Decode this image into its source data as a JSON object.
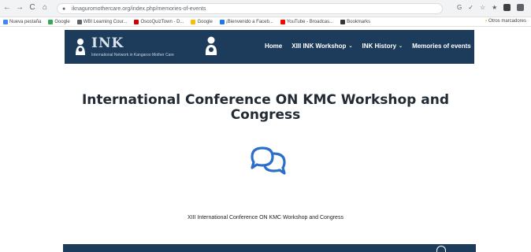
{
  "browser": {
    "url": "iknaguromothercare.org/index.php/memories-of-events",
    "bookmarks": [
      {
        "label": "Nueva pestaña",
        "color": "#4285f4"
      },
      {
        "label": "Google",
        "color": "#34a853"
      },
      {
        "label": "WBI Learning Cour...",
        "color": "#5f6368"
      },
      {
        "label": "OscoQuizTown - D...",
        "color": "#cc0000"
      },
      {
        "label": "Google",
        "color": "#fbbc05"
      },
      {
        "label": "¡Bienvenido a Faceb...",
        "color": "#1877f2"
      },
      {
        "label": "YouTube - Broadcas...",
        "color": "#ff0000"
      },
      {
        "label": "Bookmarks",
        "color": "#333333"
      }
    ],
    "other_bookmarks": "Otros marcadores"
  },
  "site": {
    "logo_text": "INK",
    "logo_subtitle": "International Network in Kangaroo Mother Care",
    "menu": [
      {
        "label": "Home",
        "dropdown": false
      },
      {
        "label": "XIII INK Workshop",
        "dropdown": true
      },
      {
        "label": "INK History",
        "dropdown": true
      },
      {
        "label": "Memories of events",
        "dropdown": false
      }
    ],
    "header_color": "#1d3c5c"
  },
  "main": {
    "title": "International Conference ON KMC Workshop and Congress",
    "icon": "chat-bubbles-icon",
    "icon_color": "#2a6fc9",
    "subtitle": "XIII International Conference ON KMC Workshop and Congress"
  }
}
